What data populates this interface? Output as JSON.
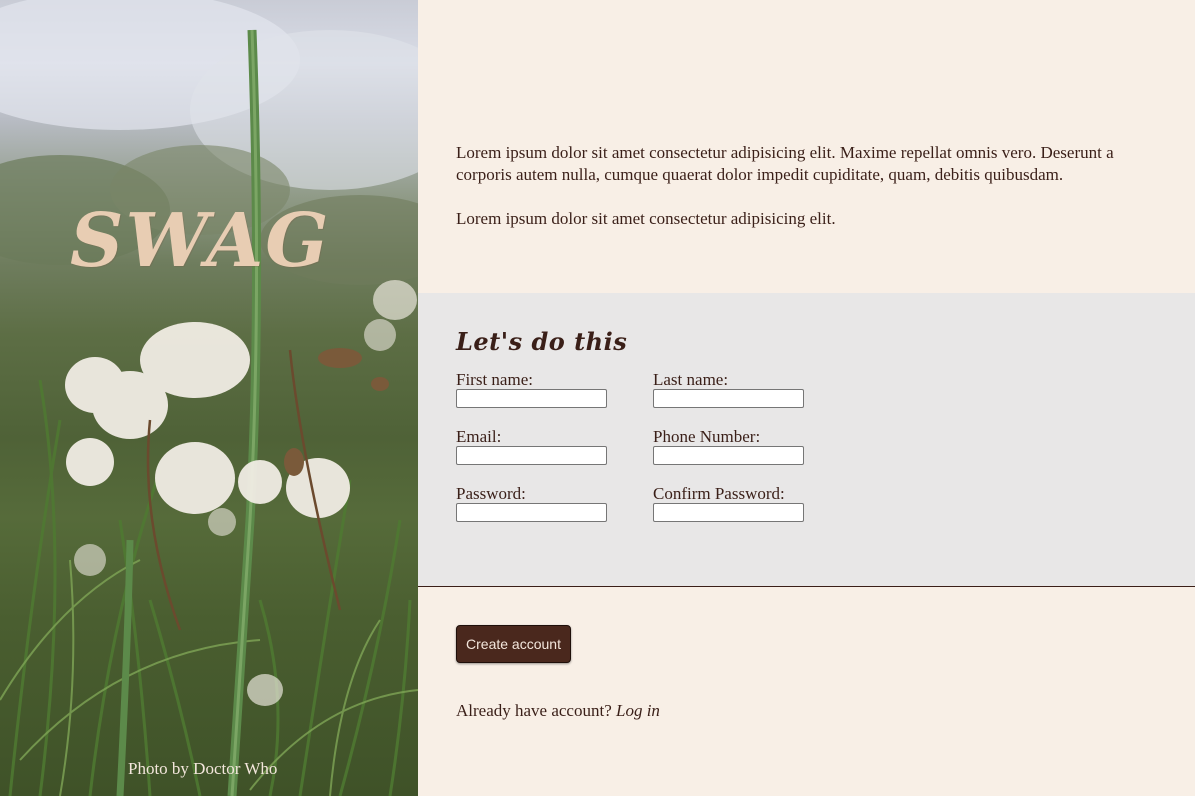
{
  "hero": {
    "logo_text": "SWAG",
    "photo_credit": "Photo by Doctor Who"
  },
  "intro": {
    "paragraph_1": "Lorem ipsum dolor sit amet consectetur adipisicing elit. Maxime repellat omnis vero. Deserunt a corporis autem nulla, cumque quaerat dolor impedit cupiditate, quam, debitis quibusdam.",
    "paragraph_2": "Lorem ipsum dolor sit amet consectetur adipisicing elit."
  },
  "form": {
    "heading": "Let's do this",
    "first_name_label": "First name:",
    "first_name_value": "",
    "last_name_label": "Last name:",
    "last_name_value": "",
    "email_label": "Email:",
    "email_value": "",
    "phone_label": "Phone Number:",
    "phone_value": "",
    "password_label": "Password:",
    "password_value": "",
    "confirm_password_label": "Confirm Password:",
    "confirm_password_value": ""
  },
  "actions": {
    "create_account_label": "Create account",
    "login_prompt": "Already have account?",
    "login_link": "Log in"
  },
  "colors": {
    "cream_background": "#f8efe6",
    "form_background": "#e8e7e7",
    "button_background": "#4a281d",
    "text_dark": "#3a1f18",
    "logo_color": "#e8cdb3"
  }
}
